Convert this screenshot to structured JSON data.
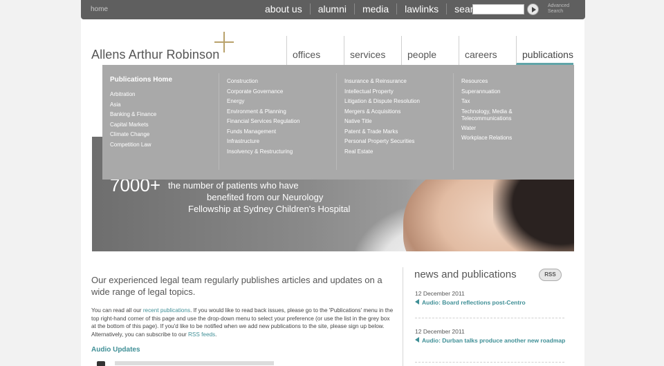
{
  "topbar": {
    "home": "home",
    "links": [
      "about us",
      "alumni",
      "media",
      "lawlinks",
      "search"
    ],
    "search_placeholder": "",
    "advanced_search": "Advanced Search"
  },
  "logo": {
    "text": "Allens Arthur Robinson"
  },
  "main_nav": [
    "offices",
    "services",
    "people",
    "careers",
    "publications"
  ],
  "mega_menu": {
    "col1": {
      "heading": "Publications Home",
      "items": [
        "Arbitration",
        "Asia",
        "Banking & Finance",
        "Capital Markets",
        "Climate Change",
        "Competition Law"
      ]
    },
    "col2": {
      "items": [
        "Construction",
        "Corporate Governance",
        "Energy",
        "Environment & Planning",
        "Financial Services Regulation",
        "Funds Management",
        "Infrastructure",
        "Insolvency & Restructuring"
      ]
    },
    "col3": {
      "items": [
        "Insurance & Reinsurance",
        "Intellectual Property",
        "Litigation & Dispute Resolution",
        "Mergers & Acquisitions",
        "Native Title",
        "Patent & Trade Marks",
        "Personal Property Securities",
        "Real Estate"
      ]
    },
    "col4": {
      "items": [
        "Resources",
        "Superannuation",
        "Tax",
        "Technology, Media & Telecommunications",
        "Water",
        "Workplace Relations"
      ]
    }
  },
  "hero": {
    "big": "7000+",
    "line1": "the number of patients who have",
    "line2": "benefited from our Neurology",
    "line3": "Fellowship at Sydney Children's Hospital"
  },
  "intro": "Our experienced legal team regularly publishes articles and updates on a wide range of legal topics.",
  "body": {
    "p1_a": "You can read all our ",
    "p1_link": "recent publications",
    "p1_b": ". If you would like to read back issues, please go to the 'Publications' menu in the top right-hand corner of this page and use the drop-down menu to select your preference (or use the list in the grey box at the bottom of this page). If you'd like to be notified when we add new publications to the site, please sign up below. Alternatively, you can subscribe to our ",
    "p1_link2": "RSS feeds",
    "p1_c": "."
  },
  "audio_heading": "Audio Updates",
  "news": {
    "heading": "news and publications",
    "rss": "RSS",
    "items": [
      {
        "date": "12 December 2011",
        "title": "Audio: Board reflections post-Centro"
      },
      {
        "date": "12 December 2011",
        "title": "Audio: Durban talks produce another new roadmap"
      }
    ]
  }
}
